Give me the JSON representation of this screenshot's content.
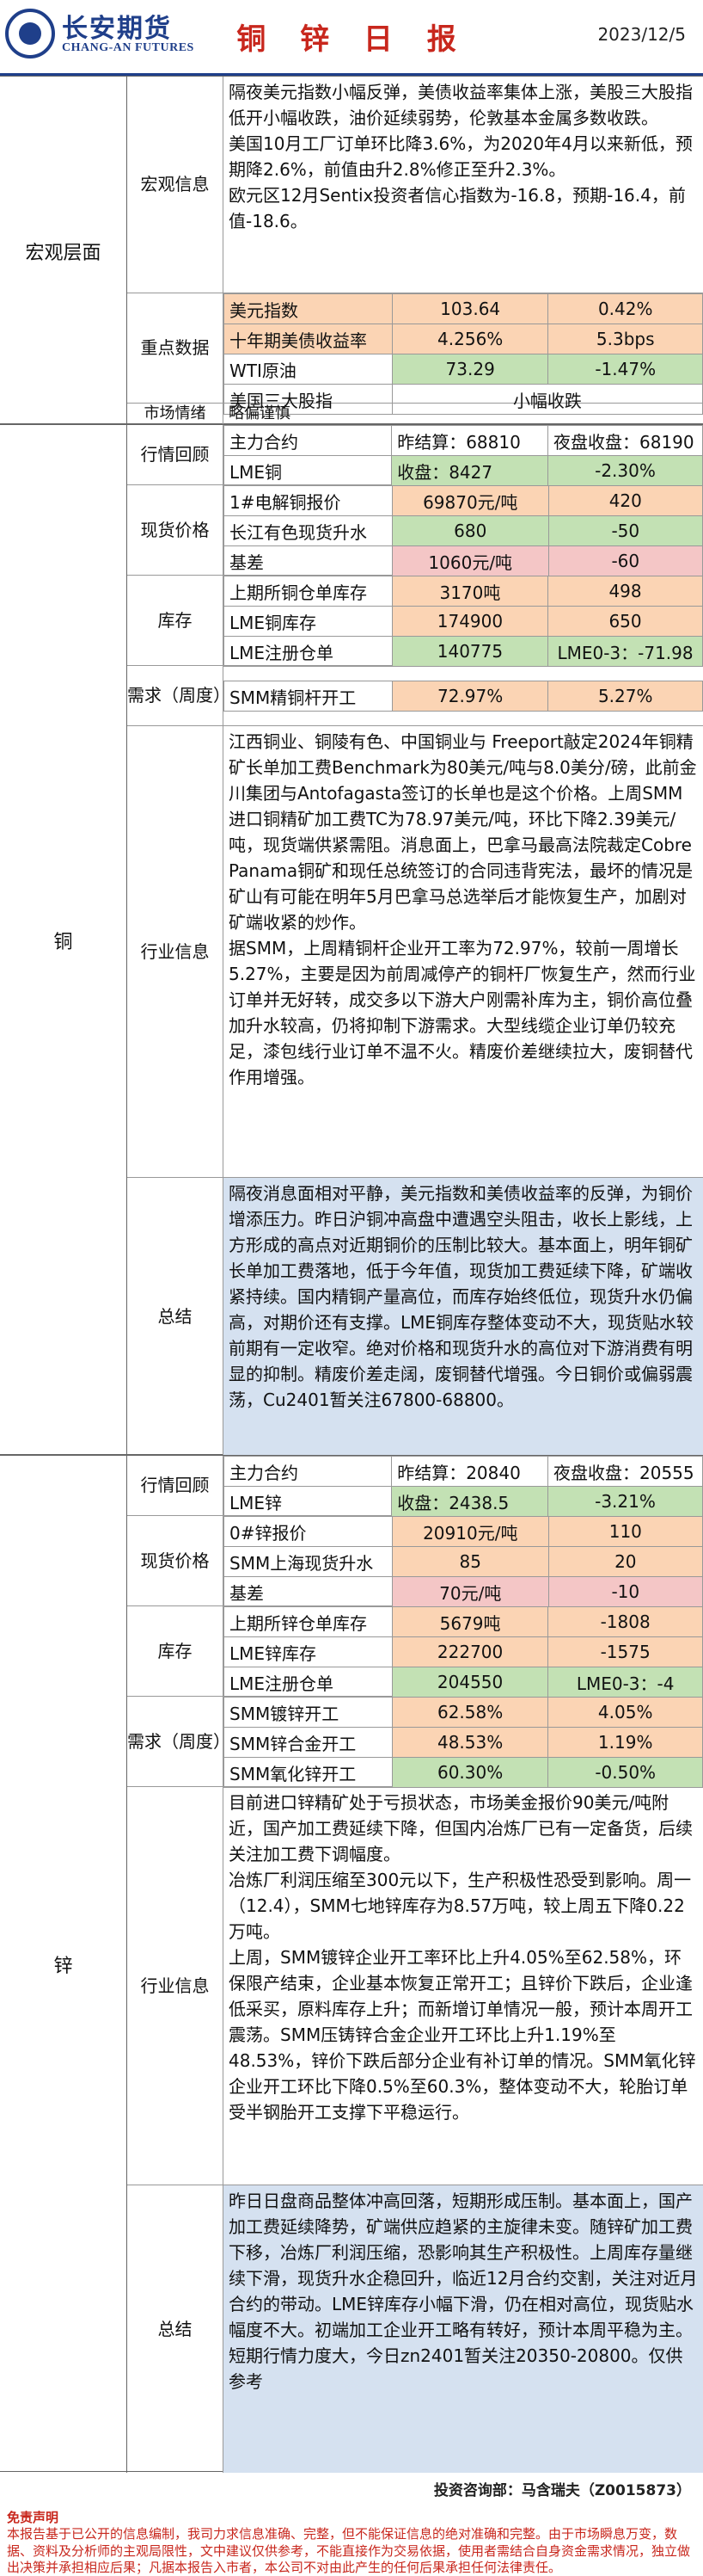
{
  "header": {
    "logo_cn": "长安期货",
    "logo_en": "CHANG-AN FUTURES",
    "title": "铜 锌 日 报",
    "date": "2023/12/5"
  },
  "macro": {
    "label": "宏观层面",
    "info_label": "宏观信息",
    "info_paragraphs": [
      "隔夜美元指数小幅反弹，美债收益率集体上涨，美股三大股指低开小幅收跌，油价延续弱势，伦敦基本金属多数收跌。",
      "美国10月工厂订单环比降3.6%，为2020年4月以来新低，预期降2.6%，前值由升2.8%修正至升2.3%。",
      "欧元区12月Sentix投资者信心指数为-16.8，预期-16.4，前值-18.6。"
    ],
    "key_label": "重点数据",
    "key_rows": [
      [
        "美元指数",
        "103.64",
        "0.42%"
      ],
      [
        "十年期美债收益率",
        "4.256%",
        "5.3bps"
      ],
      [
        "WTI原油",
        "73.29",
        "-1.47%"
      ],
      [
        "美国三大股指",
        "小幅收跌"
      ]
    ],
    "sentiment_label": "市场情绪",
    "sentiment_value": "略偏谨慎"
  },
  "copper": {
    "label": "铜",
    "quote_label": "行情回顾",
    "quote_rows": [
      [
        "主力合约",
        "昨结算：68810",
        "夜盘收盘：68190"
      ],
      [
        "LME铜",
        "收盘：8427",
        "-2.30%"
      ]
    ],
    "spot_label": "现货价格",
    "spot_rows": [
      [
        "1#电解铜报价",
        "69870元/吨",
        "420"
      ],
      [
        "长江有色现货升水",
        "680",
        "-50"
      ],
      [
        "基差",
        "1060元/吨",
        "-60"
      ]
    ],
    "stock_label": "库存",
    "stock_rows": [
      [
        "上期所铜仓单库存",
        "3170吨",
        "498"
      ],
      [
        "LME铜库存",
        "174900",
        "650"
      ],
      [
        "LME注册仓单",
        "140775",
        "LME0-3：-71.98"
      ]
    ],
    "demand_label": "需求（周度）",
    "demand_rows": [
      [
        "SMM精铜杆开工",
        "72.97%",
        "5.27%"
      ]
    ],
    "industry_label": "行业信息",
    "industry_paragraphs": [
      "江西铜业、铜陵有色、中国铜业与 Freeport敲定2024年铜精矿长单加工费Benchmark为80美元/吨与8.0美分/磅，此前金川集团与Antofagasta签订的长单也是这个价格。上周SMM进口铜精矿加工费TC为78.97美元/吨，环比下降2.39美元/吨，现货端供紧需阻。消息面上，巴拿马最高法院裁定Cobre Panama铜矿和现任总统签订的合同违背宪法，最坏的情况是矿山有可能在明年5月巴拿马总选举后才能恢复生产，加剧对矿端收紧的炒作。",
      "据SMM，上周精铜杆企业开工率为72.97%，较前一周增长5.27%，主要是因为前周减停产的铜杆厂恢复生产，然而行业订单并无好转，成交多以下游大户刚需补库为主，铜价高位叠加升水较高，仍将抑制下游需求。大型线缆企业订单仍较充足，漆包线行业订单不温不火。精废价差继续拉大，废铜替代作用增强。"
    ],
    "summary_label": "总结",
    "summary_text": "隔夜消息面相对平静，美元指数和美债收益率的反弹，为铜价增添压力。昨日沪铜冲高盘中遭遇空头阻击，收长上影线，上方形成的高点对近期铜价的压制比较大。基本面上，明年铜矿长单加工费落地，低于今年值，现货加工费延续下降，矿端收紧持续。国内精铜产量高位，而库存始终低位，现货升水仍偏高，对期价还有支撑。LME铜库存整体变动不大，现货贴水较前期有一定收窄。绝对价格和现货升水的高位对下游消费有明显的抑制。精废价差走阔，废铜替代增强。今日铜价或偏弱震荡，Cu2401暂关注67800-68800。"
  },
  "zinc": {
    "label": "锌",
    "quote_label": "行情回顾",
    "quote_rows": [
      [
        "主力合约",
        "昨结算：20840",
        "夜盘收盘：20555"
      ],
      [
        "LME锌",
        "收盘：2438.5",
        "-3.21%"
      ]
    ],
    "spot_label": "现货价格",
    "spot_rows": [
      [
        "0#锌报价",
        "20910元/吨",
        "110"
      ],
      [
        "SMM上海现货升水",
        "85",
        "20"
      ],
      [
        "基差",
        "70元/吨",
        "-10"
      ]
    ],
    "stock_label": "库存",
    "stock_rows": [
      [
        "上期所锌仓单库存",
        "5679吨",
        "-1808"
      ],
      [
        "LME锌库存",
        "222700",
        "-1575"
      ],
      [
        "LME注册仓单",
        "204550",
        "LME0-3：-4"
      ]
    ],
    "demand_label": "需求（周度）",
    "demand_rows": [
      [
        "SMM镀锌开工",
        "62.58%",
        "4.05%"
      ],
      [
        "SMM锌合金开工",
        "48.53%",
        "1.19%"
      ],
      [
        "SMM氧化锌开工",
        "60.30%",
        "-0.50%"
      ]
    ],
    "industry_label": "行业信息",
    "industry_paragraphs": [
      "目前进口锌精矿处于亏损状态，市场美金报价90美元/吨附近，国产加工费延续下降，但国内冶炼厂已有一定备货，后续关注加工费下调幅度。",
      "冶炼厂利润压缩至300元以下，生产积极性恐受到影响。周一（12.4），SMM七地锌库存为8.57万吨，较上周五下降0.22万吨。",
      "上周，SMM镀锌企业开工率环比上升4.05%至62.58%，环保限产结束，企业基本恢复正常开工；且锌价下跌后，企业逢低采买，原料库存上升；而新增订单情况一般，预计本周开工震荡。SMM压铸锌合金企业开工环比上升1.19%至48.53%，锌价下跌后部分企业有补订单的情况。SMM氧化锌企业开工环比下降0.5%至60.3%，整体变动不大，轮胎订单受半钢胎开工支撑下平稳运行。"
    ],
    "summary_label": "总结",
    "summary_text": "昨日日盘商品整体冲高回落，短期形成压制。基本面上，国产加工费延续降势，矿端供应趋紧的主旋律未变。随锌矿加工费下移，冶炼厂利润压缩，恐影响其生产积极性。上周库存量继续下滑，现货升水企稳回升，临近12月合约交割，关注对近月合约的带动。LME锌库存小幅下滑，仍在相对高位，现货贴水幅度不大。初端加工企业开工略有转好，预计本周平稳为主。短期行情力度大，今日zn2401暂关注20350-20800。仅供参考"
  },
  "footer": {
    "analyst": "投资咨询部：马含瑞夫（Z0015873）",
    "disclaimer_title": "免责声明",
    "disclaimer_text": "本报告基于已公开的信息编制，我司力求信息准确、完整，但不能保证信息的绝对准确和完整。由于市场瞬息万变，数据、资料及分析师的主观局限性，文中建议仅供参考，不能直接作为交易依据，使用者需结合自身资金需求情况，独立做出决策并承担相应后果；凡据本报告入市者，本公司不对由此产生的任何后果承担任何法律责任。"
  }
}
